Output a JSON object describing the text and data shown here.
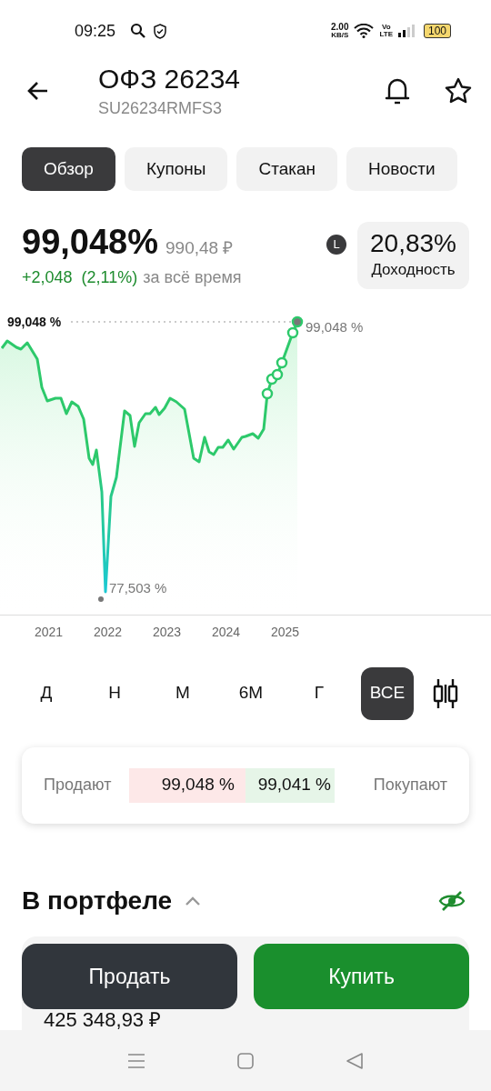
{
  "status_bar": {
    "time": "09:25",
    "speed": "2.00",
    "speed_unit": "KB/S",
    "volte": "Vo",
    "lte": "LTE",
    "battery": "100"
  },
  "header": {
    "title": "ОФЗ 26234",
    "subtitle": "SU26234RMFS3"
  },
  "tabs": [
    {
      "label": "Обзор",
      "selected": true
    },
    {
      "label": "Купоны",
      "selected": false
    },
    {
      "label": "Стакан",
      "selected": false
    },
    {
      "label": "Новости",
      "selected": false
    }
  ],
  "price": {
    "value": "99,048%",
    "rub": "990,48 ₽",
    "change": "+2,048",
    "change_pct": "(2,11%)",
    "period": "за всё время",
    "badge": "L",
    "yield": "20,83%",
    "yield_label": "Доходность"
  },
  "chart": {
    "last_label": "99,048 %",
    "end_label": "99,048 %",
    "min_label": "77,503 %",
    "years": [
      "2021",
      "2022",
      "2023",
      "2024",
      "2025"
    ]
  },
  "periods": [
    {
      "label": "Д",
      "selected": false
    },
    {
      "label": "Н",
      "selected": false
    },
    {
      "label": "М",
      "selected": false
    },
    {
      "label": "6М",
      "selected": false
    },
    {
      "label": "Г",
      "selected": false
    },
    {
      "label": "ВСЕ",
      "selected": true
    }
  ],
  "quotes": {
    "sell_label": "Продают",
    "sell": "99,048 %",
    "buy": "99,041 %",
    "buy_label": "Покупают"
  },
  "portfolio": {
    "title": "В портфеле",
    "expanded": true,
    "amount": "425 348,93 ₽"
  },
  "actions": {
    "sell": "Продать",
    "buy": "Купить"
  }
}
